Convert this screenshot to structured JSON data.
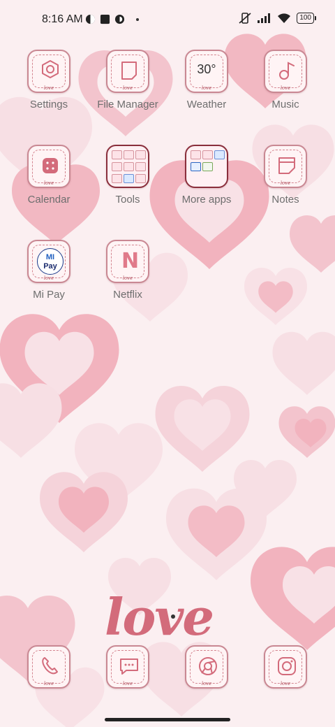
{
  "status_bar": {
    "time": "8:16 AM",
    "battery": "100"
  },
  "apps": [
    {
      "label": "Settings",
      "icon": "settings-icon"
    },
    {
      "label": "File Manager",
      "icon": "file-manager-icon"
    },
    {
      "label": "Weather",
      "icon": "weather-icon",
      "temp": "30°"
    },
    {
      "label": "Music",
      "icon": "music-note-icon"
    },
    {
      "label": "Calendar",
      "icon": "calendar-icon"
    },
    {
      "label": "Tools",
      "icon": "folder-icon"
    },
    {
      "label": "More apps",
      "icon": "folder-icon"
    },
    {
      "label": "Notes",
      "icon": "notes-icon"
    },
    {
      "label": "Mi Pay",
      "icon": "mi-pay-icon",
      "badge_top": "MI",
      "badge_bottom": "Pay"
    },
    {
      "label": "Netflix",
      "icon": "netflix-icon",
      "letter": "N"
    }
  ],
  "dock": [
    {
      "icon": "phone-icon"
    },
    {
      "icon": "messages-icon"
    },
    {
      "icon": "chrome-icon"
    },
    {
      "icon": "camera-icon"
    }
  ],
  "icon_tag": "love",
  "wallpaper_text": "love",
  "colors": {
    "background": "#fbeff1",
    "heart_dark": "#f2b8c2",
    "heart_light": "#f6dde2",
    "accent": "#c98893"
  }
}
